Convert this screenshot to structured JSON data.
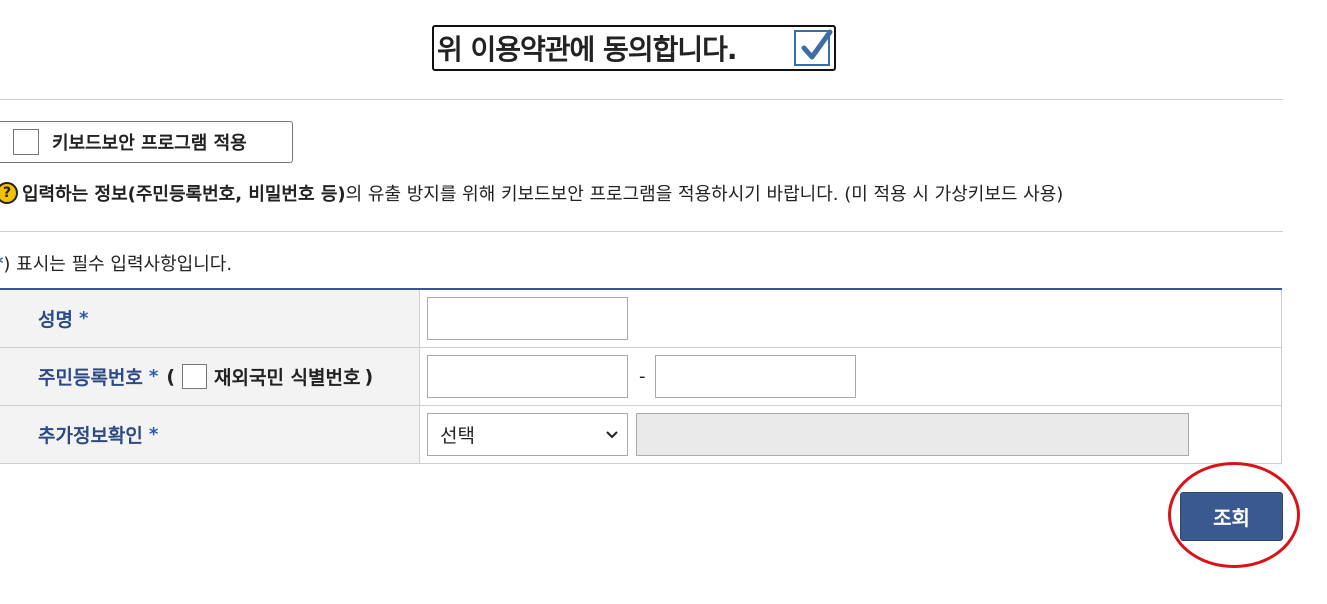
{
  "agreement": {
    "text": "위 이용약관에 동의합니다.",
    "checked": true
  },
  "keyboard_security": {
    "label": "키보드보안 프로그램 적용",
    "checked": false
  },
  "notice": {
    "icon": "?",
    "bold_text": "입력하는 정보(주민등록번호, 비밀번호 등)",
    "text": "의 유출 방지를 위해 키보드보안 프로그램을 적용하시기 바랍니다. (미 적용 시 가상키보드 사용)"
  },
  "required_note": {
    "star": "*",
    "text": ") 표시는 필수 입력사항입니다."
  },
  "form": {
    "required_mark": "*",
    "name_label": "성명",
    "name_value": "",
    "rrn_label": "주민등록번호",
    "rrn_paren_open": "(",
    "foreign_label": "재외국민 식별번호",
    "rrn_paren_close": ")",
    "rrn_front_value": "",
    "rrn_dash": "-",
    "rrn_back_value": "",
    "extra_label": "추가정보확인",
    "extra_select_value": "선택",
    "extra_value": ""
  },
  "actions": {
    "search_label": "조회"
  },
  "colors": {
    "accent": "#3a5a8f",
    "label": "#2e4a86",
    "highlight": "#d9131a",
    "notice_icon": "#f2c200"
  },
  "icons": {
    "agree_check": "checkmark-icon",
    "help": "question-circle-icon",
    "select_arrow": "chevron-down-icon"
  }
}
